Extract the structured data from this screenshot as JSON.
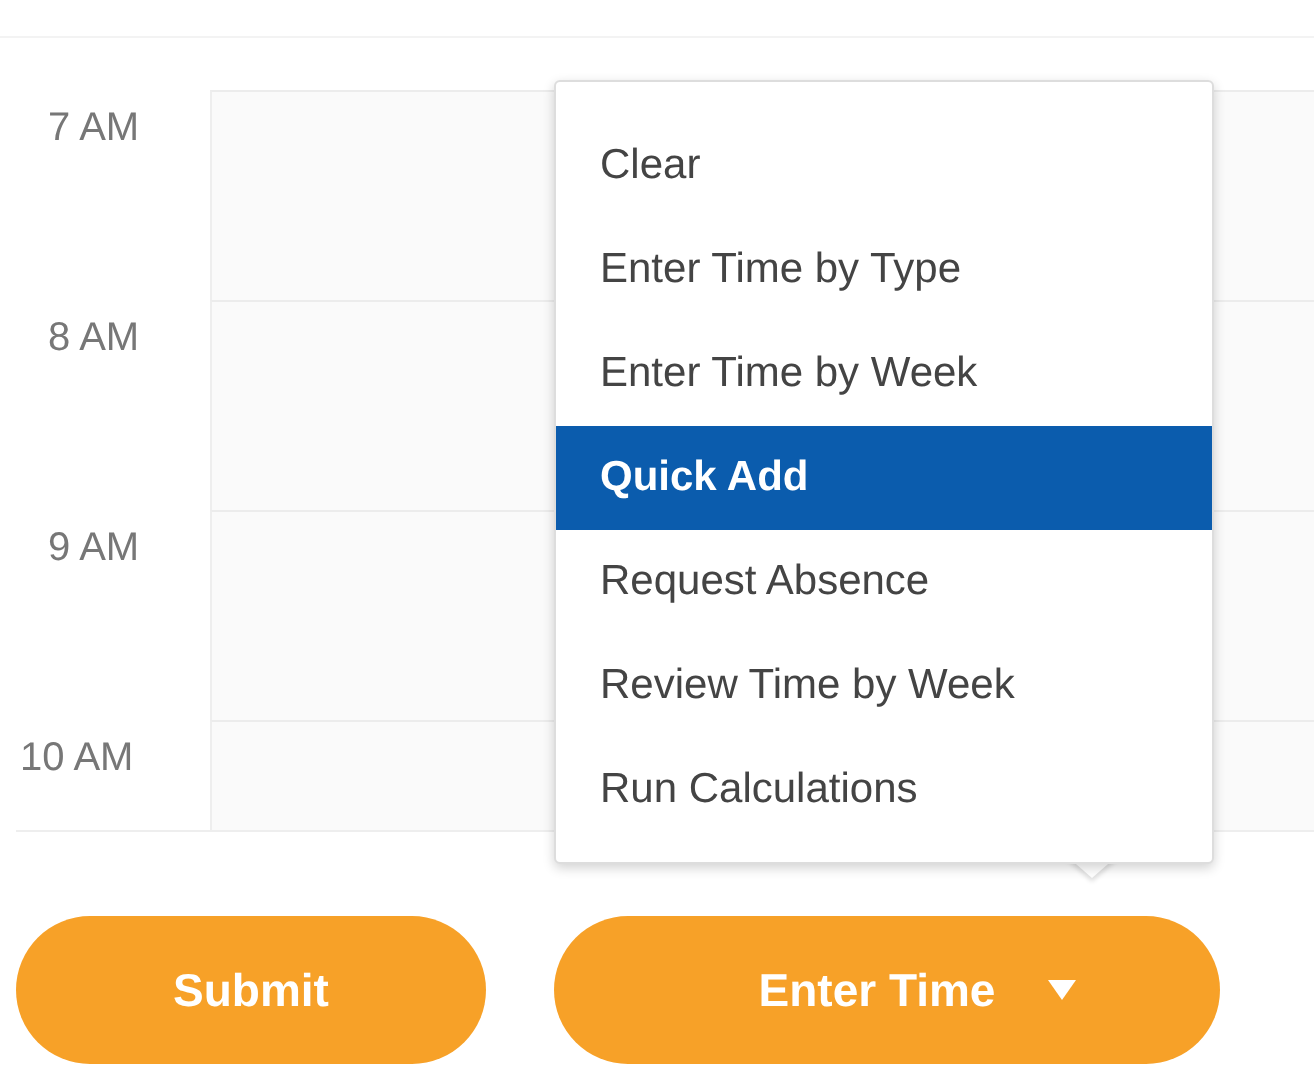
{
  "calendar": {
    "hours": [
      "7 AM",
      "8 AM",
      "9 AM",
      "10 AM"
    ]
  },
  "menu": {
    "items": [
      {
        "label": "Clear",
        "selected": false
      },
      {
        "label": "Enter Time by Type",
        "selected": false
      },
      {
        "label": "Enter Time by Week",
        "selected": false
      },
      {
        "label": "Quick Add",
        "selected": true
      },
      {
        "label": "Request Absence",
        "selected": false
      },
      {
        "label": "Review Time by Week",
        "selected": false
      },
      {
        "label": "Run Calculations",
        "selected": false
      }
    ]
  },
  "buttons": [
    {
      "label": "Submit",
      "kind": "plain"
    },
    {
      "label": "Enter Time",
      "kind": "dropdown"
    }
  ]
}
